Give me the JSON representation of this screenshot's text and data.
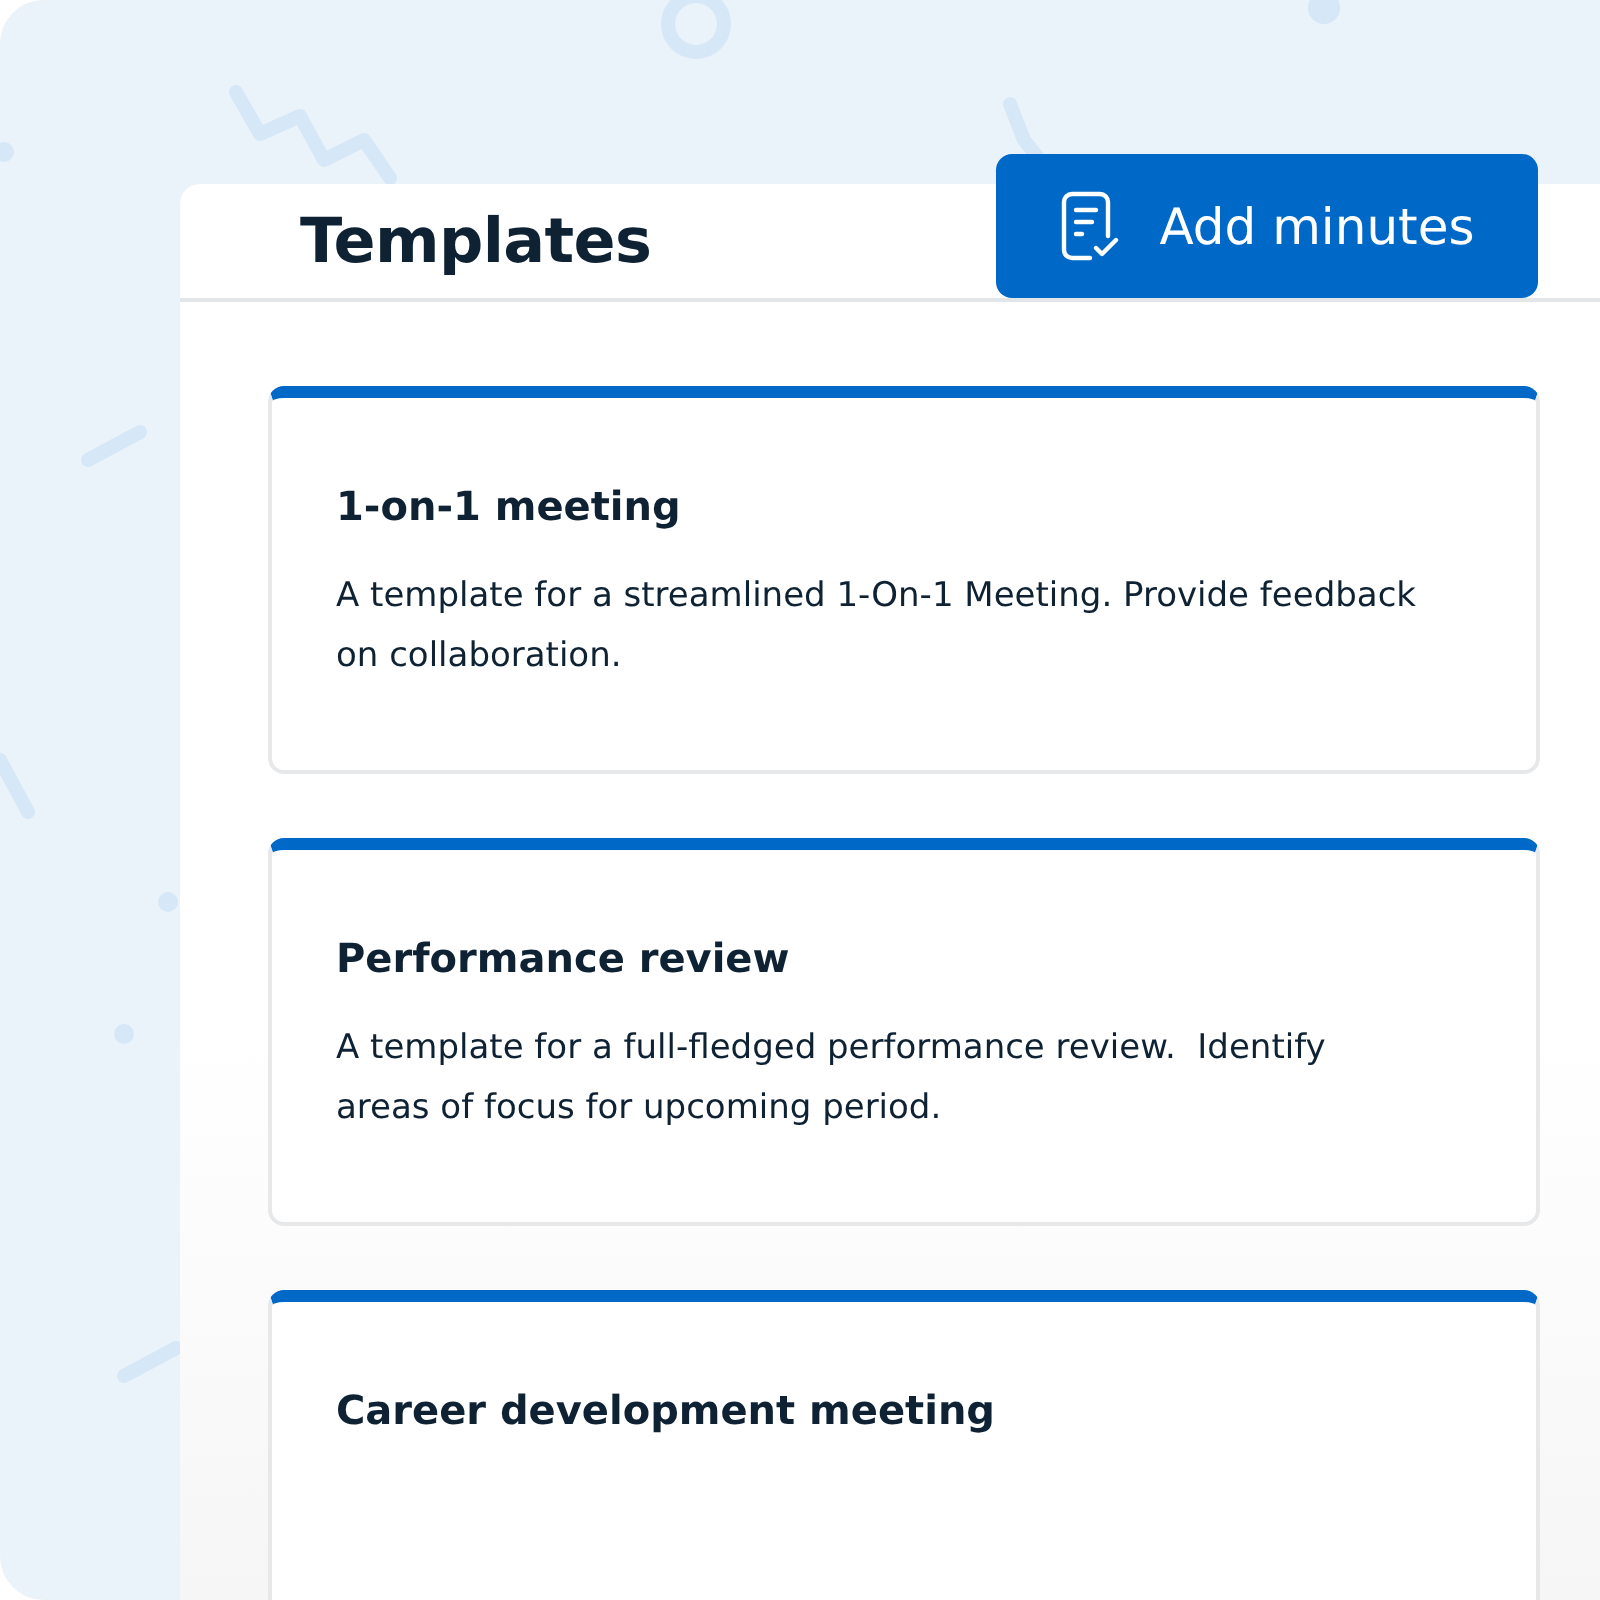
{
  "header": {
    "title": "Templates",
    "add_button": {
      "label": "Add minutes"
    }
  },
  "templates": [
    {
      "title": "1-on-1 meeting",
      "description": "A template for a streamlined 1-On-1 Meeting. Provide feedback on collaboration."
    },
    {
      "title": "Performance review",
      "description": "A template for a full-fledged performance review.  Identify areas of focus for upcoming period."
    },
    {
      "title": "Career development meeting"
    }
  ]
}
